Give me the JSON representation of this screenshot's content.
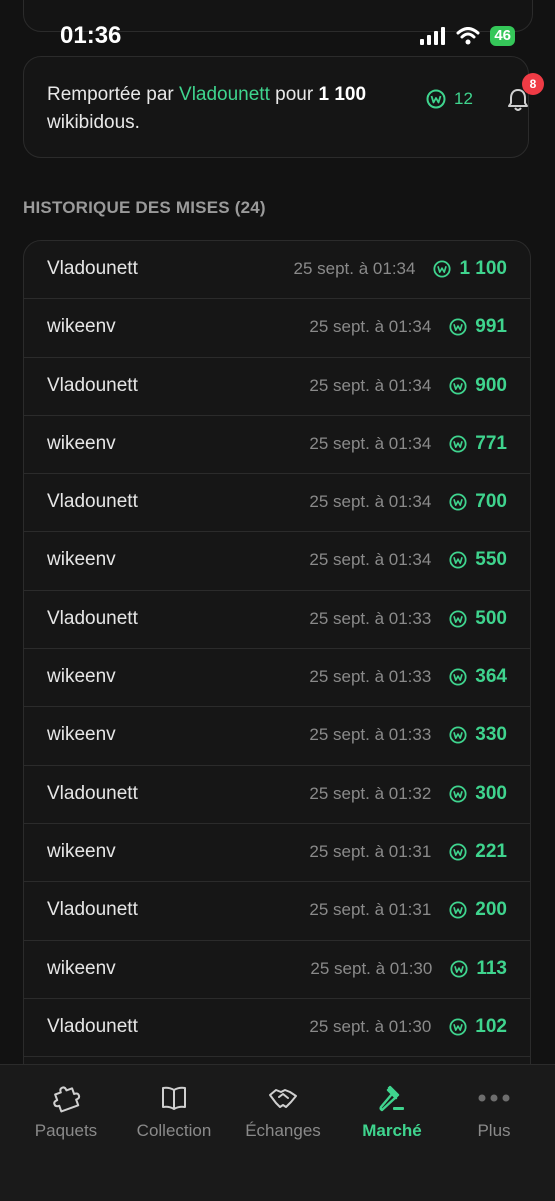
{
  "status": {
    "time": "01:36",
    "battery": "46"
  },
  "card": {
    "prefix": "Remportée par ",
    "winner": "Vladounett",
    "middle": " pour ",
    "amount": "1 100",
    "suffix": " wikibidous.",
    "coins": "12",
    "notifications": "8"
  },
  "history": {
    "title": "HISTORIQUE DES MISES (24)",
    "rows": [
      {
        "bidder": "Vladounett",
        "date": "25 sept. à 01:34",
        "amount": "1 100"
      },
      {
        "bidder": "wikeenv",
        "date": "25 sept. à 01:34",
        "amount": "991"
      },
      {
        "bidder": "Vladounett",
        "date": "25 sept. à 01:34",
        "amount": "900"
      },
      {
        "bidder": "wikeenv",
        "date": "25 sept. à 01:34",
        "amount": "771"
      },
      {
        "bidder": "Vladounett",
        "date": "25 sept. à 01:34",
        "amount": "700"
      },
      {
        "bidder": "wikeenv",
        "date": "25 sept. à 01:34",
        "amount": "550"
      },
      {
        "bidder": "Vladounett",
        "date": "25 sept. à 01:33",
        "amount": "500"
      },
      {
        "bidder": "wikeenv",
        "date": "25 sept. à 01:33",
        "amount": "364"
      },
      {
        "bidder": "wikeenv",
        "date": "25 sept. à 01:33",
        "amount": "330"
      },
      {
        "bidder": "Vladounett",
        "date": "25 sept. à 01:32",
        "amount": "300"
      },
      {
        "bidder": "wikeenv",
        "date": "25 sept. à 01:31",
        "amount": "221"
      },
      {
        "bidder": "Vladounett",
        "date": "25 sept. à 01:31",
        "amount": "200"
      },
      {
        "bidder": "wikeenv",
        "date": "25 sept. à 01:30",
        "amount": "113"
      },
      {
        "bidder": "Vladounett",
        "date": "25 sept. à 01:30",
        "amount": "102"
      }
    ]
  },
  "tabs": [
    {
      "label": "Paquets",
      "icon": "puzzle-icon",
      "active": false
    },
    {
      "label": "Collection",
      "icon": "book-icon",
      "active": false
    },
    {
      "label": "Échanges",
      "icon": "handshake-icon",
      "active": false
    },
    {
      "label": "Marché",
      "icon": "gavel-icon",
      "active": true
    },
    {
      "label": "Plus",
      "icon": "more-icon",
      "active": false
    }
  ],
  "colors": {
    "accent": "#3fd48e",
    "background": "#121212",
    "badge": "#ef3b45"
  }
}
